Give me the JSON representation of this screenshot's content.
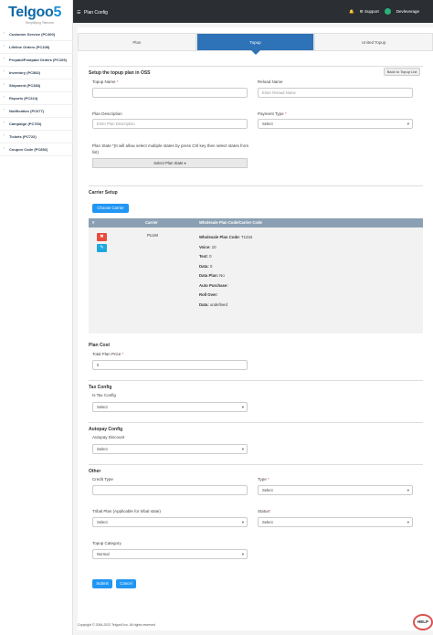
{
  "brand": {
    "logo_main": "Telgoo",
    "logo_num": "5",
    "logo_sub": "Simplifying Telecom"
  },
  "sidebar": {
    "items": [
      {
        "label": "Customer Service (PC400)"
      },
      {
        "label": "Lifeline Orders (PC108)"
      },
      {
        "label": "Prepaid/Postpaid Orders (PC109)"
      },
      {
        "label": "Inventory (PC582)"
      },
      {
        "label": "Shipment (PC383)"
      },
      {
        "label": "Reports (PC224)"
      },
      {
        "label": "Notification (PC677)"
      },
      {
        "label": "Campaign (PC760)"
      },
      {
        "label": "Tickets (PC722)"
      },
      {
        "label": "Coupon Code (PC852)"
      }
    ]
  },
  "topbar": {
    "title": "Plan Config",
    "support": "Support",
    "user": "Devleverage"
  },
  "tabs": [
    {
      "label": "Plan"
    },
    {
      "label": "Topup"
    },
    {
      "label": "United Topup"
    }
  ],
  "form": {
    "section_setup": "Setup the topup plan in OSS",
    "back_btn": "Back to Topup List",
    "topup_name_label": "Topup Name",
    "reload_name_label": "Reload Name",
    "reload_name_placeholder": "Enter Reload Name",
    "plan_desc_label": "Plan Description",
    "plan_desc_placeholder": "Enter Plan Description",
    "payment_type_label": "Payment Type",
    "payment_type_value": "Select",
    "plan_state_label": "Plan State *(It will allow select multiple states by press Ctrl key then select states from list)",
    "plan_state_btn": "Select Plan State ▾",
    "carrier_setup": "Carrier Setup",
    "choose_carrier": "Choose Carrier",
    "table_headers": [
      "#",
      "Carrier",
      "Wholesale Plan Code/Carrier Code"
    ],
    "carrier_name": "PLUM",
    "carrier_details": [
      {
        "k": "Wholesale Plan Code:",
        "v": "T1234"
      },
      {
        "k": "Voice:",
        "v": "10"
      },
      {
        "k": "Text:",
        "v": "0"
      },
      {
        "k": "Data:",
        "v": "0"
      },
      {
        "k": "Data Plan:",
        "v": "No"
      },
      {
        "k": "Auto Purchase:",
        "v": ""
      },
      {
        "k": "Roll Over:",
        "v": ""
      },
      {
        "k": "Data:",
        "v": "undefined"
      }
    ],
    "plan_cost": "Plan Cost",
    "total_price_label": "Total Plan Price",
    "total_price_value": "0",
    "tax_config": "Tax Config",
    "is_tax_label": "Is Tax Config",
    "is_tax_value": "Select",
    "autopay": "Autopay Config",
    "autopay_discount_label": "Autopay Discount",
    "autopay_discount_value": "Select",
    "other": "Other",
    "credit_type_label": "Credit Type",
    "type_label": "Type",
    "type_value": "Select",
    "tribal_label": "Tribal Plan (Applicable for tribal state)",
    "tribal_value": "Select",
    "status_label": "Status",
    "status_value": "Select",
    "topup_cat_label": "Topup Category",
    "topup_cat_value": "Normal",
    "submit": "Submit",
    "cancel": "Cancel"
  },
  "footer": {
    "text": "Copyright © 2006-2022 Telgoo5 Inc. All rights reserved"
  },
  "help": "HELP"
}
